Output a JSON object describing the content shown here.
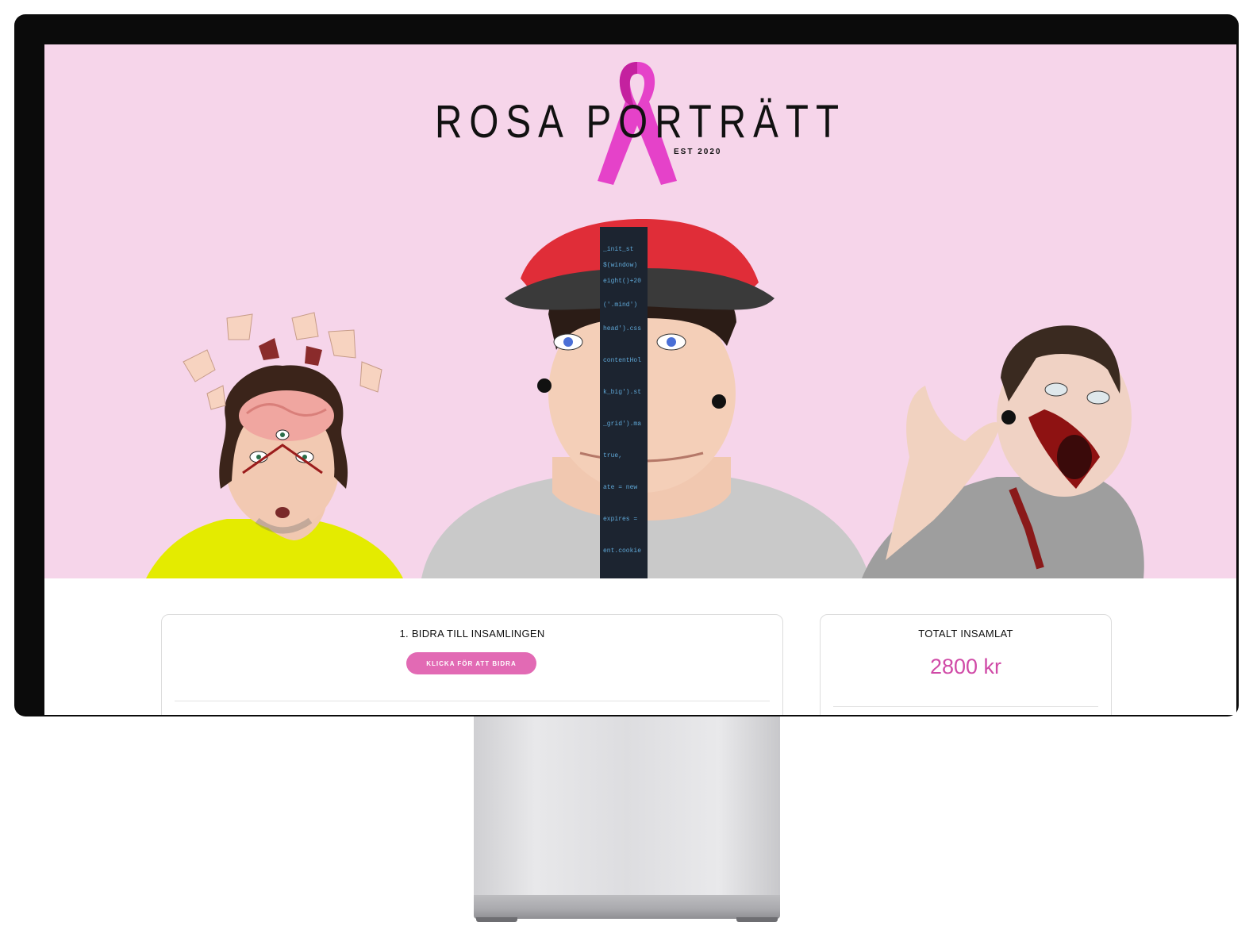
{
  "site": {
    "logo_title": "ROSA PORTRÄTT",
    "logo_est": "EST 2020",
    "ribbon_color": "#e542c9"
  },
  "contribute_card": {
    "title": "1. BIDRA TILL INSAMLINGEN",
    "button_label": "KLICKA FÖR ATT BIDRA"
  },
  "total_card": {
    "title": "TOTALT INSAMLAT",
    "amount": "2800 kr"
  },
  "colors": {
    "hero_background": "#f6d5ea",
    "accent_pink": "#e26ab4",
    "amount_pink": "#d04aa7",
    "bezel": "#0b0b0b"
  }
}
